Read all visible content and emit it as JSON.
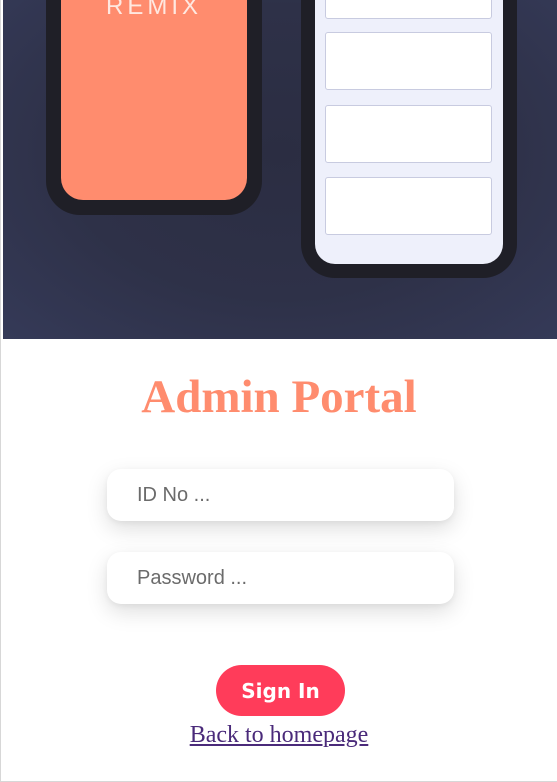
{
  "hero": {
    "brand_text": "REMIX",
    "colors": {
      "background": "#2e3148",
      "phone_frame": "#1f1f27",
      "left_screen": "#ff8c6e",
      "right_screen": "#eef0fb"
    }
  },
  "login": {
    "title": "Admin Portal",
    "id_placeholder": "ID No ...",
    "password_placeholder": "Password ...",
    "id_value": "",
    "password_value": "",
    "signin_label": "Sign In",
    "back_link_label": "Back to homepage",
    "colors": {
      "title": "#ff8c6e",
      "signin_button": "#ff3c5a",
      "link": "#4a2a7a"
    }
  }
}
